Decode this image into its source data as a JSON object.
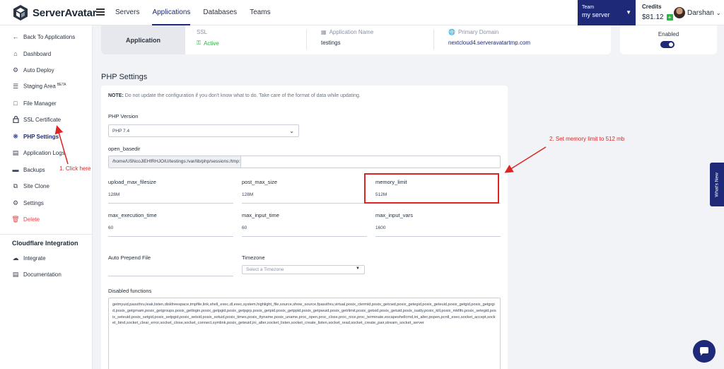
{
  "brand": {
    "name": "ServerAvatar"
  },
  "nav": {
    "items": [
      "Servers",
      "Applications",
      "Databases",
      "Teams"
    ],
    "active": "Applications"
  },
  "team": {
    "label": "Team",
    "value": "my server"
  },
  "credits": {
    "label": "Credits",
    "value": "$81.12"
  },
  "user": {
    "name": "Darshan"
  },
  "sidebar": {
    "back": "Back To Applications",
    "items": [
      {
        "label": "Dashboard",
        "icon": "home-icon"
      },
      {
        "label": "Auto Deploy",
        "icon": "gear-icon"
      },
      {
        "label": "Staging Area",
        "icon": "layers-icon",
        "badge": "BETA"
      },
      {
        "label": "File Manager",
        "icon": "file-icon"
      },
      {
        "label": "SSL Certificate",
        "icon": "lock-icon"
      },
      {
        "label": "PHP Settings",
        "icon": "php-icon"
      },
      {
        "label": "Application Logs",
        "icon": "document-icon"
      },
      {
        "label": "Backups",
        "icon": "archive-icon"
      },
      {
        "label": "Site Clone",
        "icon": "copy-icon"
      },
      {
        "label": "Settings",
        "icon": "gear-icon"
      },
      {
        "label": "Delete",
        "icon": "trash-icon"
      }
    ],
    "active": "PHP Settings",
    "section_title": "Cloudflare Integration",
    "section_items": [
      {
        "label": "Integrate",
        "icon": "cloud-icon"
      },
      {
        "label": "Documentation",
        "icon": "book-icon"
      }
    ]
  },
  "app_header": {
    "tab": "Application",
    "ssl": {
      "label": "SSL",
      "value": "Active"
    },
    "app_name": {
      "label": "Application Name",
      "value": "testings"
    },
    "domain": {
      "label": "Primary Domain",
      "value": "nextcloud4.serveravatartmp.com"
    },
    "status": {
      "label": "Enabled",
      "on": true
    }
  },
  "php": {
    "title": "PHP Settings",
    "note_prefix": "NOTE:",
    "note": "Do not update the configuration if you don't know what to do. Take care of the format of data while updating.",
    "version_label": "PHP Version",
    "version_value": "PHP 7.4",
    "basedir_label": "open_basedir",
    "basedir_value": "/home/U5NcoJlEHfRHJOIU/testings:/var/lib/php/sessions:/tmp:",
    "fields": [
      {
        "label": "upload_max_filesize",
        "value": "128M"
      },
      {
        "label": "post_max_size",
        "value": "128M"
      },
      {
        "label": "memory_limit",
        "value": "512M"
      },
      {
        "label": "max_execution_time",
        "value": "60"
      },
      {
        "label": "max_input_time",
        "value": "60"
      },
      {
        "label": "max_input_vars",
        "value": "1600"
      }
    ],
    "prepend_label": "Auto Prepend File",
    "timezone_label": "Timezone",
    "timezone_placeholder": "Select a Timezone",
    "disabled_label": "Disabled functions",
    "disabled_value": "getmyuid,passthru,leak,listen,diskfreespace,tmpfile,link,shell_exec,dl,exec,system,highlight_file,source,show_source,fpassthru,virtual,posix_ctermid,posix_getcwd,posix_getegid,posix_geteuid,posix_getgid,posix_getgrgid,posix_getgrnam,posix_getgroups,posix_getlogin,posix_getpgid,posix_getpgrp,posix_getpid,posix_getppid,posix_getpwuid,posix_getrlimit,posix_getsid,posix_getuid,posix_isatty,posix_kill,posix_mkfifo,posix_setegid,posix_seteuid,posix_setgid,posix_setpgid,posix_setsid,posix_setuid,posix_times,posix_ttyname,posix_uname,proc_open,proc_close,proc_nice,proc_terminate,escapeshellcmd,ini_alter,popen,pcntl_exec,socket_accept,socket_bind,socket_clear_error,socket_close,socket_connect,symlink,posix_geteuid,ini_alter,socket_listen,socket_create_listen,socket_read,socket_create_pair,stream_socket_server"
  },
  "annotations": {
    "step1": "1. Click here",
    "step2": "2. Set memory limit to 512 mb",
    "color": "#e02424"
  },
  "whats_new": "What's New",
  "colors": {
    "primary": "#1e2a78",
    "success": "#2fb344",
    "danger": "#e5484d"
  }
}
